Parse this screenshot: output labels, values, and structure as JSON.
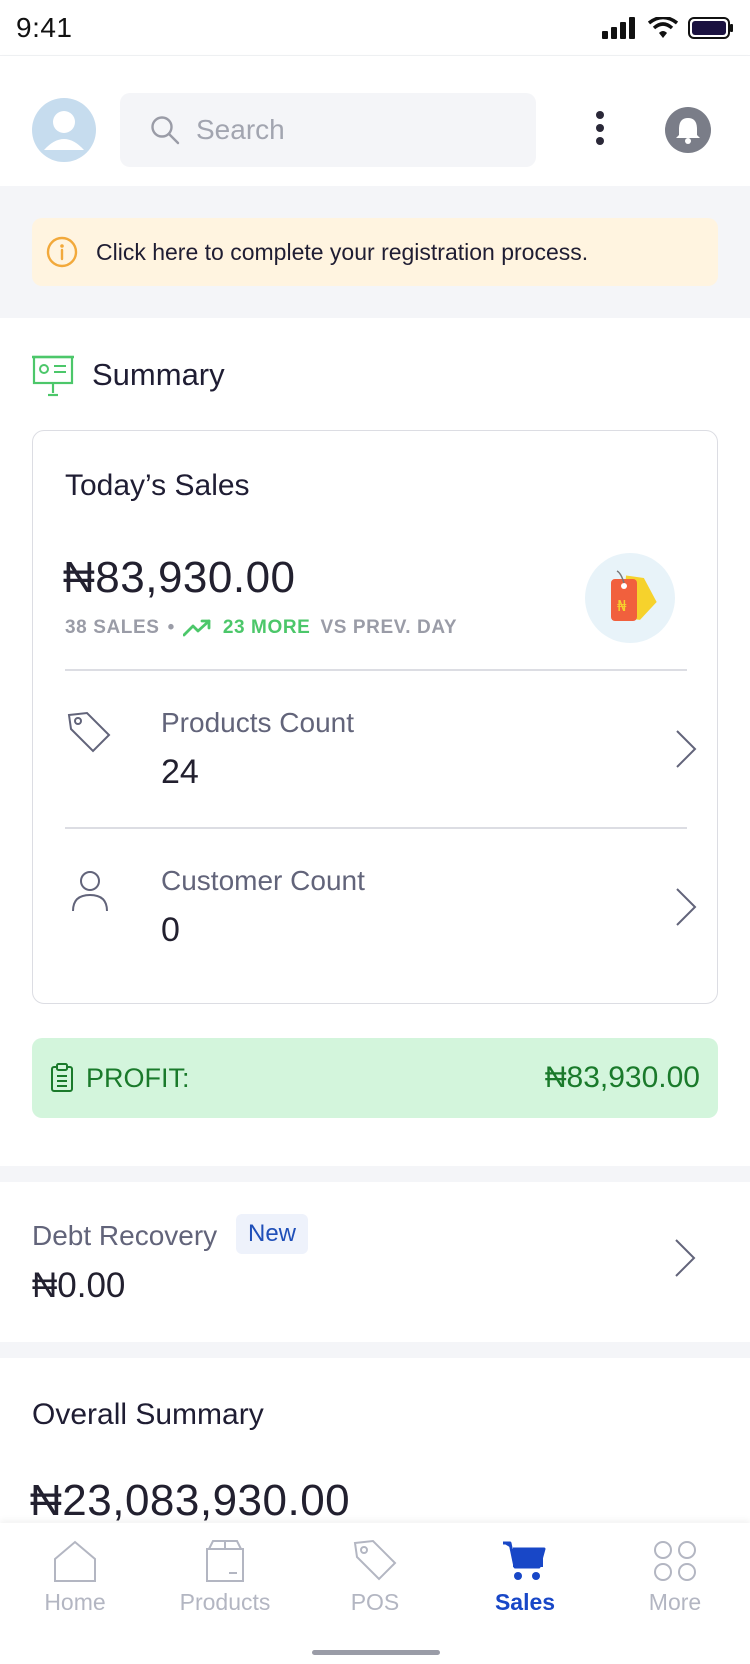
{
  "status_bar": {
    "time": "9:41"
  },
  "header": {
    "search_placeholder": "Search"
  },
  "registration_banner": {
    "text": "Click here to complete your registration process."
  },
  "summary": {
    "title": "Summary",
    "todays_sales": {
      "title": "Today’s Sales",
      "amount": "₦83,930.00",
      "sales_count": "38 SALES",
      "bullet": "•",
      "more": "23 MORE",
      "vs": "VS PREV. DAY"
    },
    "products": {
      "label": "Products Count",
      "value": "24"
    },
    "customers": {
      "label": "Customer Count",
      "value": "0"
    },
    "profit": {
      "label": "PROFIT:",
      "value": "₦83,930.00"
    }
  },
  "debt_recovery": {
    "label": "Debt Recovery",
    "badge": "New",
    "value": "₦0.00"
  },
  "overall_summary": {
    "title": "Overall Summary",
    "value": "₦23,083,930.00"
  },
  "bottom_nav": {
    "items": [
      {
        "label": "Home",
        "icon": "home-icon",
        "active": false
      },
      {
        "label": "Products",
        "icon": "box-icon",
        "active": false
      },
      {
        "label": "POS",
        "icon": "tag-icon",
        "active": false
      },
      {
        "label": "Sales",
        "icon": "cart-icon",
        "active": true
      },
      {
        "label": "More",
        "icon": "grid-icon",
        "active": false
      }
    ]
  },
  "colors": {
    "accent": "#1847c7",
    "green": "#4cc76a",
    "profit_text": "#1a7a2b",
    "profit_bg": "#d3f5dc",
    "banner_bg": "#fff4e0"
  }
}
